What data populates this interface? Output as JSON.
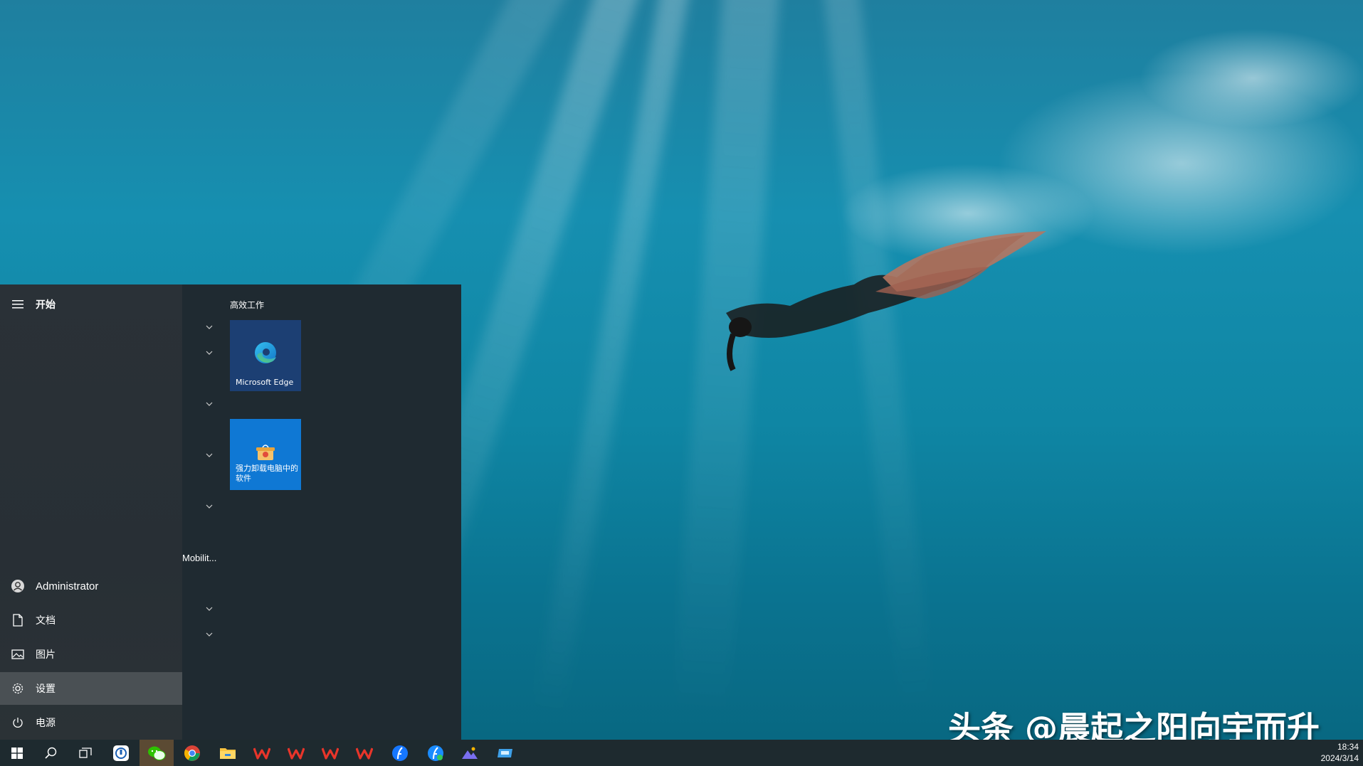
{
  "start_menu": {
    "header": "开始",
    "group_title": "高效工作",
    "tiles": [
      {
        "label": "Microsoft Edge",
        "icon": "edge-icon"
      },
      {
        "label": "强力卸载电脑中的软件",
        "icon": "uninstall-box-icon"
      }
    ],
    "app_list_partial": "Mobilit...",
    "rail": {
      "user": "Administrator",
      "documents": "文档",
      "pictures": "图片",
      "settings": "设置",
      "power": "电源"
    }
  },
  "taskbar": {
    "items": [
      "windows-start-icon",
      "search-icon",
      "task-view-icon",
      "app-icon",
      "wechat-icon",
      "chrome-icon",
      "file-explorer-icon",
      "wps-icon",
      "wps-icon",
      "wps-icon",
      "wps-icon",
      "feishu-icon",
      "feishu-icon",
      "photos-icon",
      "remote-icon"
    ],
    "time": "18:34",
    "date": "2024/3/14"
  },
  "watermark": "头条 @晨起之阳向宇而升",
  "colors": {
    "accent": "#0f78d4",
    "edge_tile": "#1c3f73",
    "menu_bg": "#1f2a31",
    "taskbar_bg": "#1e2a2f"
  }
}
